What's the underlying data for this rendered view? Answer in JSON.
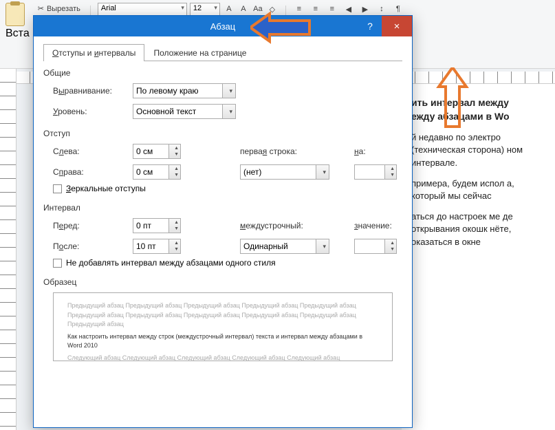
{
  "ribbon": {
    "cut": "Вырезать",
    "paste": "Вста",
    "font_name": "Arial",
    "font_size": "12",
    "paragraph_group": "Абзац"
  },
  "document": {
    "title_line1": "ить интервал между",
    "title_line2": "ежду абзацами в Wo",
    "p1": "й недавно по электро (техническая сторона) ном интервале.",
    "p2": "примера, будем испол а, который мы сейчас",
    "p3": "аться до настроек ме де открывания окошк нёте, оказаться в окне"
  },
  "dialog": {
    "title": "Абзац",
    "help": "?",
    "close": "×",
    "tabs": {
      "indents": "Отступы и интервалы",
      "position": "Положение на странице"
    },
    "general": {
      "label": "Общие",
      "alignment_label": "Выравнивание:",
      "alignment_value": "По левому краю",
      "level_label": "Уровень:",
      "level_value": "Основной текст"
    },
    "indent": {
      "label": "Отступ",
      "left_label": "Слева:",
      "left_value": "0 см",
      "right_label": "Справа:",
      "right_value": "0 см",
      "firstline_label": "первая строка:",
      "firstline_value": "(нет)",
      "by_label": "на:",
      "by_value": "",
      "mirror": "Зеркальные отступы"
    },
    "spacing": {
      "label": "Интервал",
      "before_label": "Перед:",
      "before_value": "0 пт",
      "after_label": "После:",
      "after_value": "10 пт",
      "line_label": "междустрочный:",
      "line_value": "Одинарный",
      "at_label": "значение:",
      "at_value": "",
      "no_space": "Не добавлять интервал между абзацами одного стиля"
    },
    "preview": {
      "label": "Образец",
      "prev_text": "Предыдущий абзац Предыдущий абзац Предыдущий абзац Предыдущий абзац Предыдущий абзац Предыдущий абзац Предыдущий абзац Предыдущий абзац Предыдущий абзац Предыдущий абзац Предыдущий абзац",
      "sample": "Как настроить интервал между строк (междустрочный интервал) текста и интервал между абзацами в Word 2010",
      "next_text": "Следующий абзац Следующий абзац Следующий абзац Следующий абзац Следующий абзац"
    }
  },
  "arrows": {
    "color": "#e8792e"
  }
}
